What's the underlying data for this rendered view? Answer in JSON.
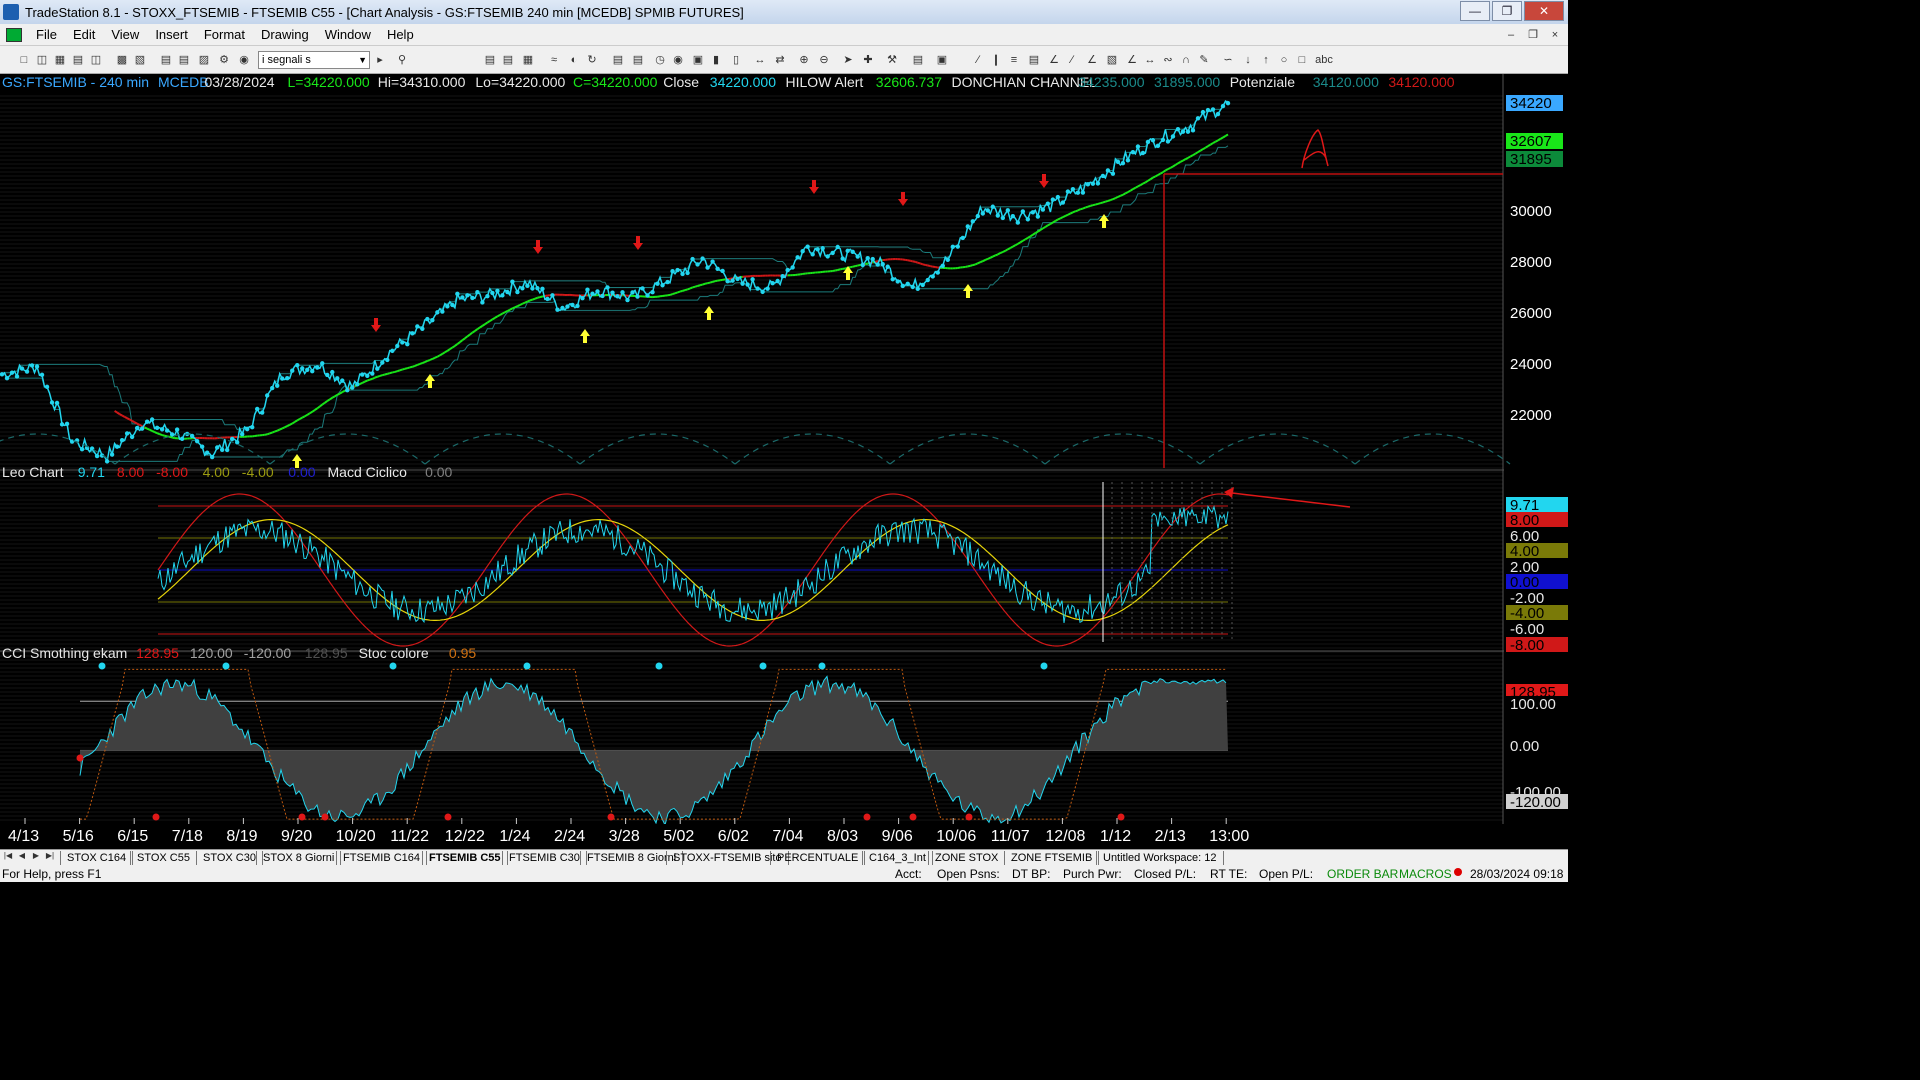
{
  "window": {
    "title": "TradeStation 8.1 - STOXX_FTSEMIB - FTSEMIB C55 - [Chart Analysis - GS:FTSEMIB  240 min  [MCEDB] SPMIB FUTURES]",
    "minimize": "—",
    "restore": "❐",
    "close": "✕"
  },
  "menu": [
    "File",
    "Edit",
    "View",
    "Insert",
    "Format",
    "Drawing",
    "Window",
    "Help"
  ],
  "mdi": {
    "minimize": "–",
    "restore": "❐",
    "close": "×"
  },
  "toolbar": {
    "combo_value": "i segnali s"
  },
  "price_panel": {
    "header": [
      {
        "text": "GS:FTSEMIB - 240 min",
        "color": "#3aa8ff"
      },
      {
        "text": "MCEDB",
        "color": "#3aa8ff"
      },
      {
        "text": "03/28/2024",
        "color": "#e8e8e8"
      },
      {
        "text": "L=34220.000",
        "color": "#19e619"
      },
      {
        "text": "Hi=34310.000",
        "color": "#e8e8e8"
      },
      {
        "text": "Lo=34220.000",
        "color": "#e8e8e8"
      },
      {
        "text": "C=34220.000",
        "color": "#19e619"
      },
      {
        "text": "Close",
        "color": "#e8e8e8"
      },
      {
        "text": "34220.000",
        "color": "#22d6ef"
      },
      {
        "text": "HILOW Alert",
        "color": "#e8e8e8"
      },
      {
        "text": "32606.737",
        "color": "#19e619"
      },
      {
        "text": "DONCHIAN CHANNEL",
        "color": "#e8e8e8"
      },
      {
        "text": "34235.000",
        "color": "#1b8a8a"
      },
      {
        "text": "31895.000",
        "color": "#1b8a8a"
      },
      {
        "text": "Potenziale",
        "color": "#e8e8e8"
      },
      {
        "text": "34120.000",
        "color": "#1b8a8a"
      },
      {
        "text": "34120.000",
        "color": "#d01818"
      }
    ],
    "axis_labels": [
      "30000",
      "28000",
      "26000",
      "24000",
      "22000"
    ],
    "axis_values": [
      30000,
      28000,
      26000,
      24000,
      22000
    ],
    "last_price": "34220",
    "hilow_value": "32607",
    "donchian_low": "31895"
  },
  "osc_panel": {
    "header": [
      {
        "text": "Leo Chart",
        "color": "#e8e8e8"
      },
      {
        "text": "9.71",
        "color": "#22d6ef"
      },
      {
        "text": "8.00",
        "color": "#e01818"
      },
      {
        "text": "-8.00",
        "color": "#e01818"
      },
      {
        "text": "4.00",
        "color": "#9a9a10"
      },
      {
        "text": "-4.00",
        "color": "#9a9a10"
      },
      {
        "text": "0.00",
        "color": "#2020d0"
      },
      {
        "text": "Macd Ciclico",
        "color": "#e8e8e8"
      },
      {
        "text": "0.00",
        "color": "#808080"
      }
    ],
    "badges": [
      {
        "text": "9.71",
        "bg": "#22d6ef",
        "color": "#000"
      },
      {
        "text": "8.00",
        "bg": "#d01818",
        "color": "#000"
      },
      {
        "text": "6.00",
        "bg": "#000",
        "color": "#e8e8e8"
      },
      {
        "text": "4.00",
        "bg": "#7a7a08",
        "color": "#000"
      },
      {
        "text": "2.00",
        "bg": "#000",
        "color": "#e8e8e8"
      },
      {
        "text": "0.00",
        "bg": "#1010d0",
        "color": "#000"
      },
      {
        "text": "-2.00",
        "bg": "#000",
        "color": "#e8e8e8"
      },
      {
        "text": "-4.00",
        "bg": "#7a7a08",
        "color": "#000"
      },
      {
        "text": "-6.00",
        "bg": "#000",
        "color": "#e8e8e8"
      },
      {
        "text": "-8.00",
        "bg": "#d01818",
        "color": "#000"
      }
    ]
  },
  "cci_panel": {
    "header": [
      {
        "text": "CCI Smothing ekam",
        "color": "#e8e8e8"
      },
      {
        "text": "128.95",
        "color": "#e01818"
      },
      {
        "text": "120.00",
        "color": "#a0a0a0"
      },
      {
        "text": "-120.00",
        "color": "#a0a0a0"
      },
      {
        "text": "128.95",
        "color": "#505050"
      },
      {
        "text": "Stoc colore",
        "color": "#e8e8e8"
      },
      {
        "text": "0.95",
        "color": "#d07010"
      }
    ],
    "badges": [
      {
        "text": "128.95",
        "bg": "#e01818",
        "color": "#000"
      },
      {
        "text": "100.00",
        "bg": "#000",
        "color": "#e8e8e8"
      },
      {
        "text": "0.00",
        "bg": "#000",
        "color": "#e8e8e8"
      },
      {
        "text": "-100.00",
        "bg": "#000",
        "color": "#e8e8e8"
      },
      {
        "text": "-120.00",
        "bg": "#d0d0d0",
        "color": "#000"
      }
    ]
  },
  "x_axis": [
    "4/13",
    "5/16",
    "6/15",
    "7/18",
    "8/19",
    "9/20",
    "10/20",
    "11/22",
    "12/22",
    "1/24",
    "2/24",
    "3/28",
    "5/02",
    "6/02",
    "7/04",
    "8/03",
    "9/06",
    "10/06",
    "11/07",
    "12/08",
    "1/12",
    "2/13",
    "13:00"
  ],
  "tabs": [
    "STOX C164",
    "STOX C55",
    "STOX  C30",
    "STOX  8 Giorni",
    "FTSEMIB C164",
    "FTSEMIB C55",
    "FTSEMIB C30",
    "FTSEMIB  8 Giorni",
    "STOXX-FTSEMIB sito",
    "PERCENTUALE",
    "C164_3_Int",
    "ZONE STOX",
    "ZONE FTSEMIB",
    "Untitled Workspace: 12"
  ],
  "active_tab": "FTSEMIB C55",
  "status": {
    "help": "For Help, press F1",
    "acct": "Acct:",
    "open_psns": "Open Psns:",
    "dt_bp": "DT BP:",
    "purch_pwr": "Purch Pwr:",
    "closed_pl": "Closed P/L:",
    "rt_te": "RT TE:",
    "open_pl": "Open P/L:",
    "order_bar": "ORDER BAR",
    "macros": "MACROS",
    "datetime": "28/03/2024 09:18"
  },
  "chart_data": {
    "type": "line",
    "price": {
      "x_index": [
        0,
        1,
        2,
        3,
        4,
        5,
        6,
        7,
        8,
        9,
        10,
        11,
        12,
        13,
        14,
        15,
        16,
        17,
        18,
        19,
        20,
        21,
        22
      ],
      "close": [
        23600,
        23900,
        21000,
        20400,
        21700,
        21300,
        20500,
        21400,
        23600,
        24000,
        23100,
        24400,
        25400,
        26500,
        26700,
        27200,
        26200,
        26900,
        26600,
        27300,
        28100,
        27200,
        27000,
        28600,
        28300,
        28000,
        27000,
        28100,
        30100,
        29800,
        30200,
        31000,
        32000,
        32800,
        33400,
        34220
      ],
      "ylim": [
        20000,
        34500
      ]
    },
    "oscillator": {
      "last": 9.71,
      "levels": [
        8,
        4,
        0,
        -4,
        -8
      ],
      "ylim": [
        -9,
        11
      ]
    },
    "cci": {
      "last": 128.95,
      "levels": [
        120,
        100,
        0,
        -100,
        -120
      ],
      "ylim": [
        -150,
        180
      ]
    }
  }
}
